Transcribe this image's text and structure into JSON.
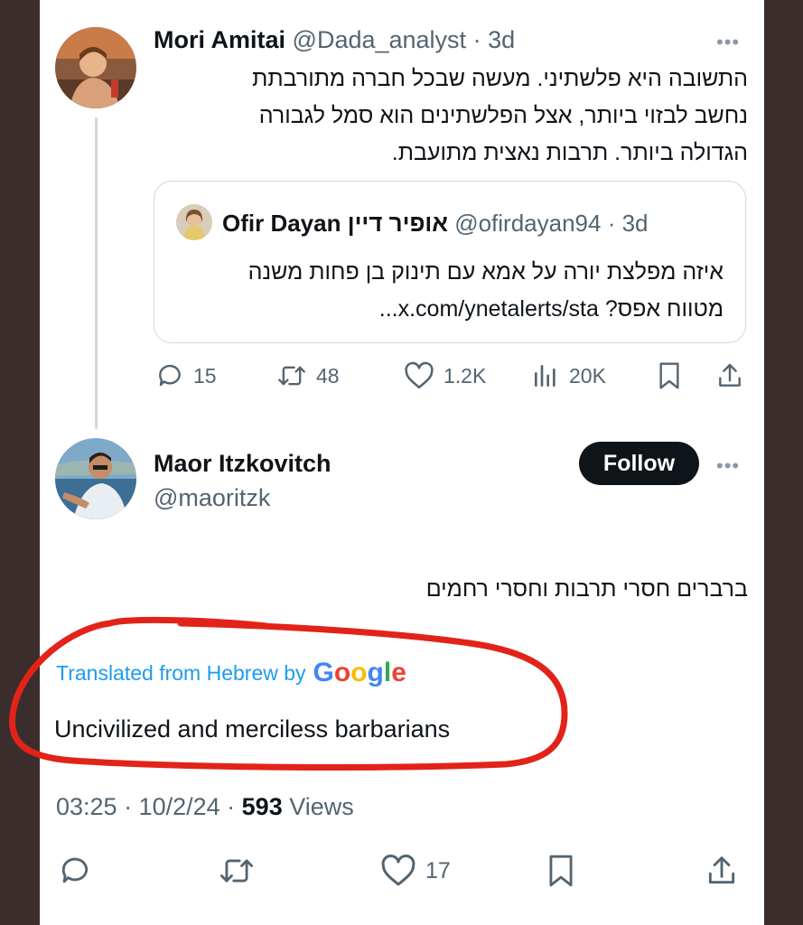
{
  "tweet1": {
    "name": "Mori Amitai",
    "handle": "@Dada_analyst",
    "time": "3d",
    "more": "•••",
    "text_lines": [
      "התשובה היא פלשתיני. מעשה שבכל חברה מתורבתת",
      "נחשב לבזוי ביותר, אצל הפלשתינים הוא סמל לגבורה",
      "הגדולה ביותר. תרבות נאצית מתועבת."
    ],
    "quote": {
      "name": "Ofir Dayan אופיר דיין",
      "handle": "@ofirdayan94",
      "time": "3d",
      "text_lines": [
        "איזה מפלצת יורה על אמא עם תינוק בן פחות משנה",
        "מטווח אפס? x.com/ynetalerts/sta..."
      ]
    },
    "actions": {
      "replies": "15",
      "retweets": "48",
      "likes": "1.2K",
      "views": "20K"
    }
  },
  "tweet2": {
    "name": "Maor Itzkovitch",
    "handle": "@maoritzk",
    "follow_label": "Follow",
    "more": "•••",
    "text": "ברברים חסרי תרבות וחסרי רחמים",
    "translated_label": "Translated from Hebrew by",
    "google": [
      "G",
      "o",
      "o",
      "g",
      "l",
      "e"
    ],
    "translation": "Uncivilized and merciless barbarians",
    "timestamp": "03:25 · 10/2/24 ·",
    "views_count": "593",
    "views_label": "Views",
    "actions": {
      "likes": "17"
    }
  },
  "colors": {
    "accent": "#1d9bf0",
    "annotation_red": "#e2231a",
    "icon_gray": "#536471"
  }
}
